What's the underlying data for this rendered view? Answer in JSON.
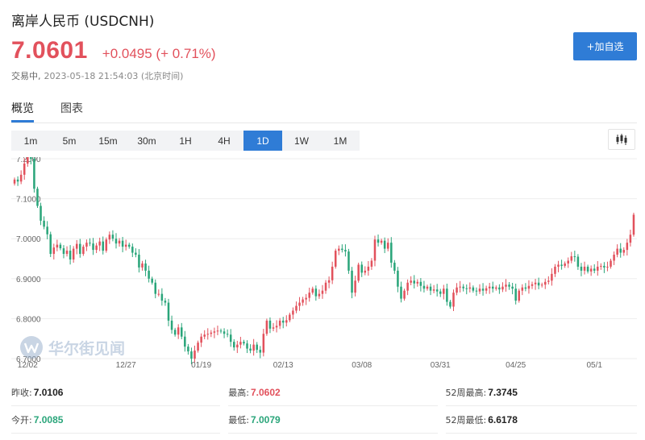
{
  "header": {
    "title": "离岸人民币  (USDCNH)",
    "price": "7.0601",
    "change": "+0.0495 (+ 0.71%)",
    "status": "交易中,",
    "timestamp": "2023-05-18 21:54:03  (北京时间)",
    "add_watchlist": "+加自选"
  },
  "tabs": [
    {
      "label": "概览",
      "active": true
    },
    {
      "label": "图表",
      "active": false
    }
  ],
  "ranges": [
    {
      "label": "1m",
      "active": false
    },
    {
      "label": "5m",
      "active": false
    },
    {
      "label": "15m",
      "active": false
    },
    {
      "label": "30m",
      "active": false
    },
    {
      "label": "1H",
      "active": false
    },
    {
      "label": "4H",
      "active": false
    },
    {
      "label": "1D",
      "active": true
    },
    {
      "label": "1W",
      "active": false
    },
    {
      "label": "1M",
      "active": false
    }
  ],
  "watermark": "华尔街见闻",
  "colors": {
    "up": "#e2515c",
    "down": "#2aa57a",
    "accent": "#2f7cd6"
  },
  "chart_data": {
    "type": "candlestick",
    "ylim": [
      6.7,
      7.15
    ],
    "y_ticks": [
      "7.2000",
      "7.1000",
      "7.0000",
      "6.9000",
      "6.8000",
      "6.7000"
    ],
    "y_tick_values": [
      7.2,
      7.1,
      7.0,
      6.9,
      6.8,
      6.7
    ],
    "x_tick_labels": [
      "12/02",
      "12/27",
      "01/19",
      "02/13",
      "03/08",
      "03/31",
      "04/25",
      "05/1"
    ],
    "x_tick_index": [
      4,
      34,
      57,
      82,
      106,
      130,
      153,
      177
    ],
    "close": [
      7.148,
      7.143,
      7.16,
      7.188,
      7.235,
      7.2,
      7.125,
      7.082,
      7.045,
      7.03,
      7.011,
      6.962,
      6.978,
      6.985,
      6.976,
      6.962,
      6.97,
      6.948,
      6.975,
      6.987,
      6.962,
      6.98,
      6.99,
      6.988,
      6.972,
      6.983,
      6.993,
      6.97,
      6.998,
      7.01,
      7.0,
      6.988,
      6.995,
      6.98,
      6.985,
      6.98,
      6.965,
      6.96,
      6.928,
      6.938,
      6.92,
      6.9,
      6.89,
      6.862,
      6.862,
      6.845,
      6.84,
      6.795,
      6.772,
      6.76,
      6.778,
      6.755,
      6.73,
      6.718,
      6.7,
      6.72,
      6.74,
      6.755,
      6.76,
      6.762,
      6.765,
      6.768,
      6.77,
      6.768,
      6.762,
      6.76,
      6.742,
      6.728,
      6.735,
      6.742,
      6.738,
      6.725,
      6.72,
      6.735,
      6.722,
      6.715,
      6.762,
      6.795,
      6.775,
      6.778,
      6.782,
      6.795,
      6.79,
      6.796,
      6.81,
      6.82,
      6.832,
      6.84,
      6.848,
      6.852,
      6.865,
      6.875,
      6.856,
      6.862,
      6.87,
      6.89,
      6.896,
      6.93,
      6.97,
      6.975,
      6.972,
      6.968,
      6.92,
      6.865,
      6.895,
      6.935,
      6.915,
      6.92,
      6.93,
      6.945,
      6.998,
      6.99,
      6.995,
      6.975,
      6.99,
      6.94,
      6.92,
      6.88,
      6.85,
      6.87,
      6.89,
      6.895,
      6.888,
      6.892,
      6.882,
      6.875,
      6.88,
      6.87,
      6.873,
      6.868,
      6.862,
      6.875,
      6.842,
      6.83,
      6.865,
      6.878,
      6.88,
      6.876,
      6.875,
      6.878,
      6.87,
      6.868,
      6.875,
      6.87,
      6.876,
      6.88,
      6.875,
      6.878,
      6.873,
      6.88,
      6.885,
      6.88,
      6.875,
      6.845,
      6.87,
      6.878,
      6.875,
      6.882,
      6.886,
      6.89,
      6.883,
      6.885,
      6.892,
      6.895,
      6.912,
      6.93,
      6.935,
      6.932,
      6.938,
      6.945,
      6.956,
      6.955,
      6.93,
      6.92,
      6.93,
      6.918,
      6.925,
      6.92,
      6.93,
      6.932,
      6.928,
      6.93,
      6.945,
      6.96,
      6.975,
      6.965,
      6.972,
      6.99,
      7.01,
      7.06
    ]
  },
  "stats": [
    [
      {
        "label": "昨收:",
        "value": "7.0106",
        "tone": "neutral"
      },
      {
        "label": "最高:",
        "value": "7.0602",
        "tone": "red"
      },
      {
        "label": "52周最高:",
        "value": "7.3745",
        "tone": "neutral"
      }
    ],
    [
      {
        "label": "今开:",
        "value": "7.0085",
        "tone": "green"
      },
      {
        "label": "最低:",
        "value": "7.0079",
        "tone": "green"
      },
      {
        "label": "52周最低:",
        "value": "6.6178",
        "tone": "neutral"
      }
    ]
  ]
}
